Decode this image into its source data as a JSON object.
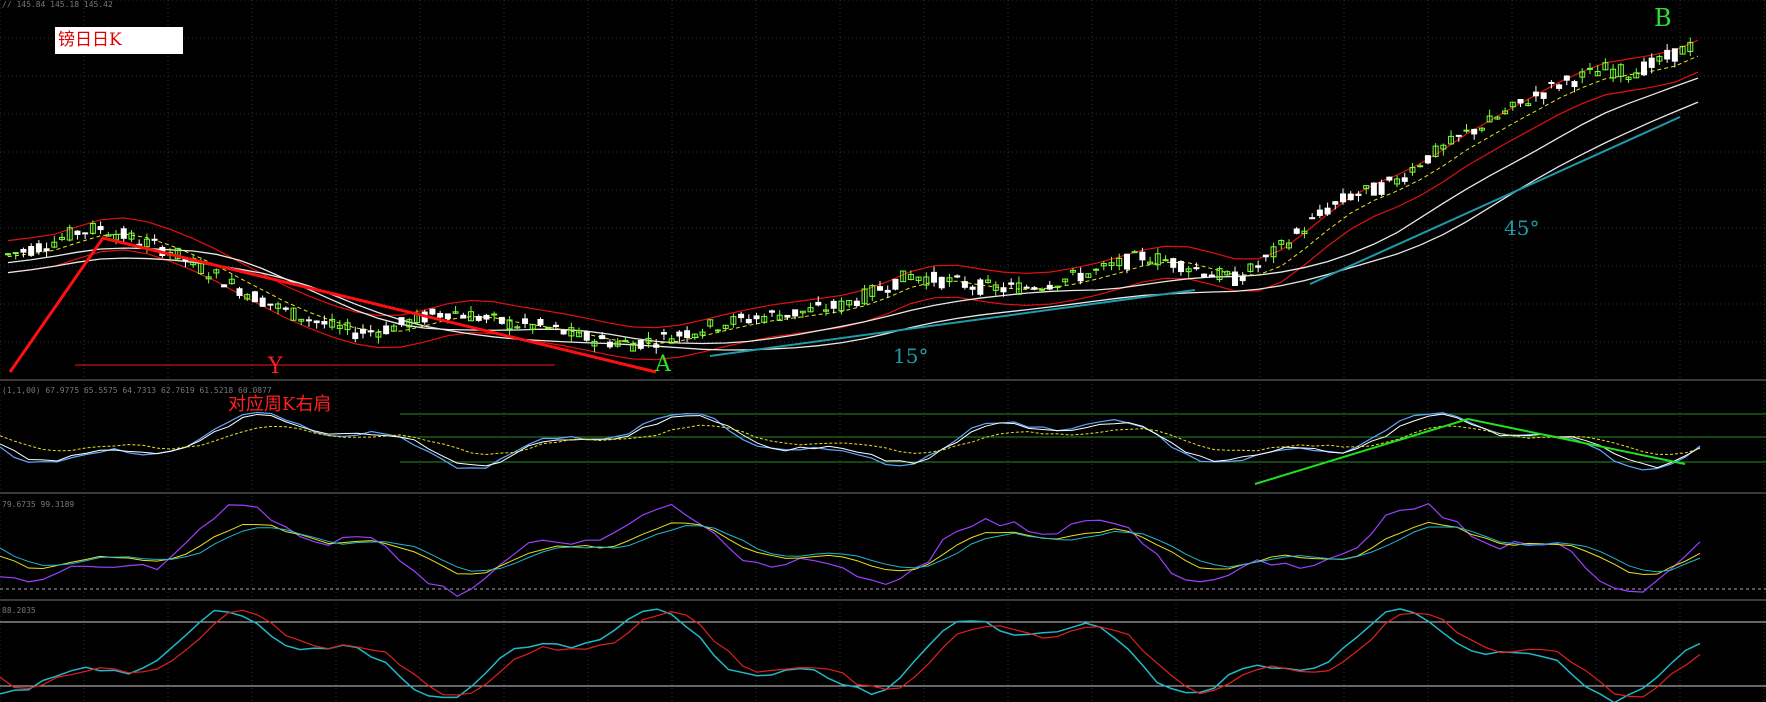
{
  "header": {
    "ohlc_readout": "// 145.84 145.18 145.42",
    "title": "镑日日K"
  },
  "indicators": {
    "panel1_readout": "(1,1,00) 67.9775 65.5575 64.7313 62.7619 61.5218 60.0877",
    "panel2_readout": "79.6735 99.3189",
    "panel3_readout": "88.2035"
  },
  "annotations": {
    "label_a": "A",
    "label_b": "B",
    "label_y": "Y",
    "label_shoulder": "对应周K右肩",
    "angle_15": "15°",
    "angle_45": "45°"
  },
  "colors": {
    "background": "#000000",
    "grid": "#2a3340",
    "candle_up": "#7cff3a",
    "candle_down": "#ffffff",
    "envelope": "#e01010",
    "ma_white": "#e8e8e8",
    "ma_yellow_dash": "#e8e820",
    "trend_red": "#ff1010",
    "trend_cyan": "#1e9aa8",
    "trend_green": "#20e020",
    "label_red": "#ff2020",
    "label_green": "#30e030",
    "label_cyan": "#1e9aa8",
    "osc_blue": "#5fa8ff",
    "osc_purple": "#9b40ff",
    "osc_yellow": "#e8e020",
    "osc_cyan": "#20b8c8",
    "osc_red": "#e02020",
    "level_line": "#2a8a2a"
  },
  "chart_data": {
    "type": "line",
    "close_series": [
      145.6,
      145.9,
      146.3,
      146.8,
      147.0,
      146.6,
      146.2,
      145.8,
      145.1,
      144.5,
      143.8,
      143.2,
      142.6,
      142.2,
      141.8,
      141.5,
      141.6,
      141.9,
      142.3,
      142.6,
      142.4,
      142.1,
      141.9,
      141.8,
      141.5,
      141.2,
      141.0,
      140.9,
      141.1,
      141.4,
      141.7,
      142.0,
      142.2,
      142.4,
      142.5,
      142.7,
      142.9,
      143.4,
      144.0,
      144.5,
      144.3,
      144.1,
      143.9,
      143.8,
      143.9,
      144.1,
      144.4,
      144.7,
      145.1,
      145.5,
      145.3,
      145.0,
      144.6,
      144.3,
      145.0,
      146.0,
      147.0,
      148.0,
      148.7,
      149.0,
      149.5,
      150.5,
      151.2,
      152.0,
      152.6,
      153.3,
      154.0,
      154.6,
      155.0,
      155.4,
      155.2,
      155.6,
      156.2,
      156.8
    ]
  }
}
